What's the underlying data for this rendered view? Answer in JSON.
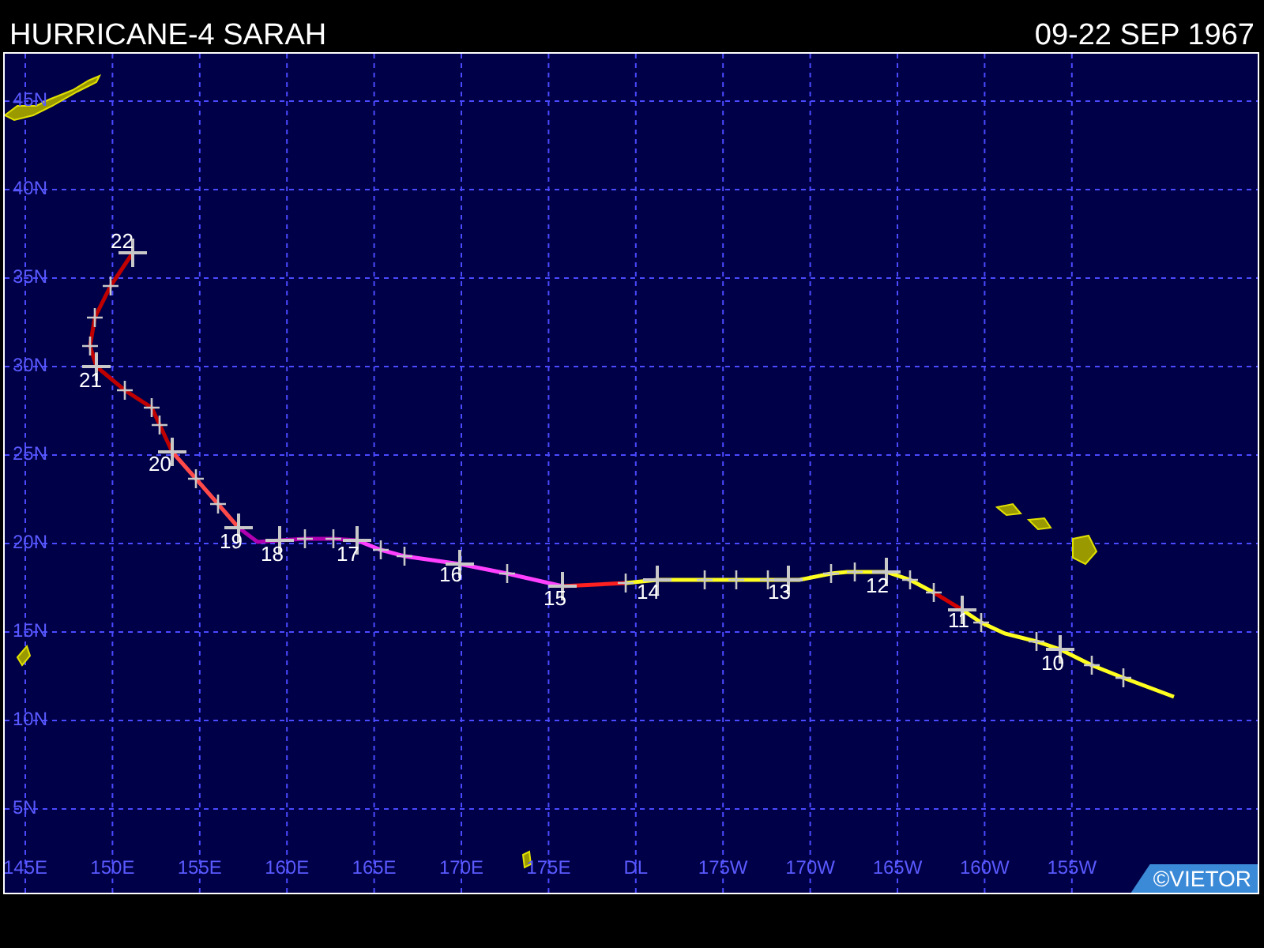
{
  "header": {
    "title": "HURRICANE-4 SARAH",
    "dates": "09-22 SEP 1967"
  },
  "map": {
    "lat_labels": [
      "45N",
      "40N",
      "35N",
      "30N",
      "25N",
      "20N",
      "15N",
      "10N",
      "5N"
    ],
    "lon_labels": [
      "145E",
      "150E",
      "155E",
      "160E",
      "165E",
      "170E",
      "175E",
      "DL",
      "175W",
      "170W",
      "165W",
      "160W",
      "155W"
    ],
    "day_labels": [
      "22",
      "21",
      "20",
      "19",
      "18",
      "17",
      "16",
      "15",
      "14",
      "13",
      "12",
      "11",
      "10"
    ],
    "credit": "©VIETOR"
  }
}
